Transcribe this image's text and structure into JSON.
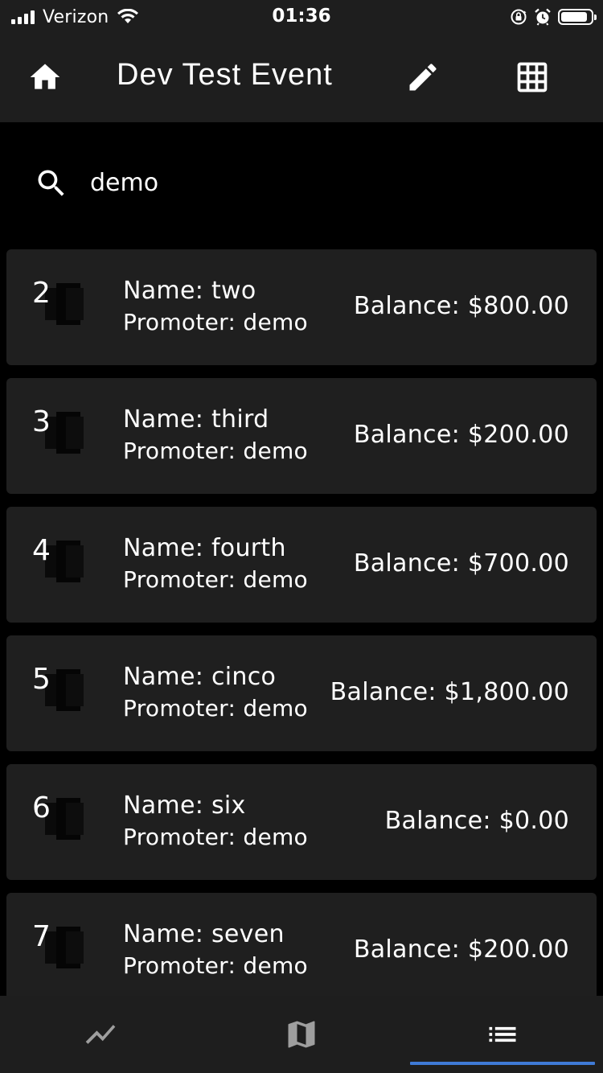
{
  "status_bar": {
    "carrier": "Verizon",
    "time": "01:36",
    "battery_level": 0.9
  },
  "app_bar": {
    "title": "Dev Test Event",
    "icons": [
      "home-icon",
      "edit-icon",
      "grid-icon"
    ]
  },
  "search": {
    "value": "demo",
    "icon": "search-icon"
  },
  "items": [
    {
      "number": "2",
      "name": "Name: two",
      "promoter": "Promoter: demo",
      "balance": "Balance: $800.00"
    },
    {
      "number": "3",
      "name": "Name: third",
      "promoter": "Promoter: demo",
      "balance": "Balance: $200.00"
    },
    {
      "number": "4",
      "name": "Name: fourth",
      "promoter": "Promoter: demo",
      "balance": "Balance: $700.00"
    },
    {
      "number": "5",
      "name": "Name: cinco",
      "promoter": "Promoter: demo",
      "balance": "Balance: $1,800.00"
    },
    {
      "number": "6",
      "name": "Name: six",
      "promoter": "Promoter: demo",
      "balance": "Balance: $0.00"
    },
    {
      "number": "7",
      "name": "Name: seven",
      "promoter": "Promoter: demo",
      "balance": "Balance: $200.00"
    }
  ],
  "bottom_nav": {
    "items": [
      "trending-icon",
      "map-icon",
      "list-icon"
    ],
    "active_index": 2,
    "accent_color": "#3f7ad6"
  }
}
